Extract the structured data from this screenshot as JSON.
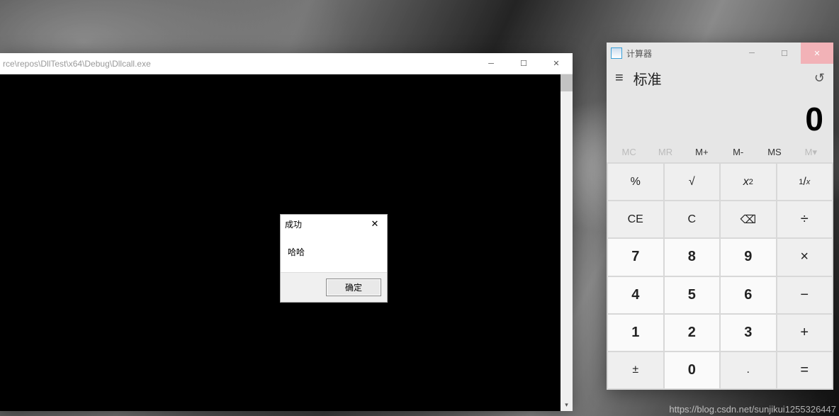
{
  "console": {
    "title": "rce\\repos\\DllTest\\x64\\Debug\\Dllcall.exe"
  },
  "msgbox": {
    "title": "成功",
    "body": "哈哈",
    "ok": "确定"
  },
  "calc": {
    "title": "计算器",
    "mode": "标准",
    "display": "0",
    "mem": {
      "mc": "MC",
      "mr": "MR",
      "mplus": "M+",
      "mminus": "M-",
      "ms": "MS",
      "mlist": "M▾"
    },
    "keys": {
      "percent": "%",
      "sqrt": "√",
      "square_base": "x",
      "square_sup": "2",
      "recip_num": "1",
      "recip_x": "x",
      "ce": "CE",
      "c": "C",
      "back": "⌫",
      "div": "÷",
      "k7": "7",
      "k8": "8",
      "k9": "9",
      "mul": "×",
      "k4": "4",
      "k5": "5",
      "k6": "6",
      "sub": "−",
      "k1": "1",
      "k2": "2",
      "k3": "3",
      "add": "+",
      "neg": "±",
      "k0": "0",
      "dot": ".",
      "eq": "="
    }
  },
  "watermark": "https://blog.csdn.net/sunjikui1255326447"
}
